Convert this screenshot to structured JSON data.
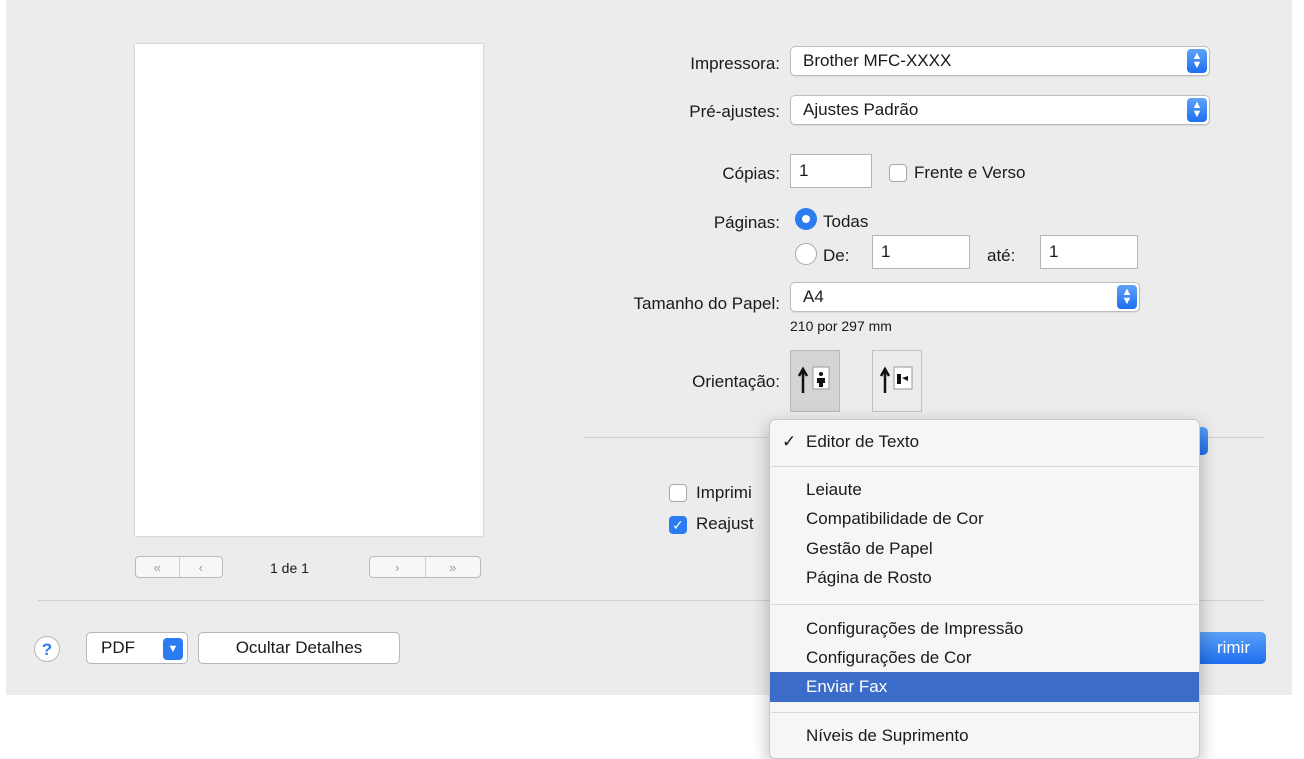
{
  "preview": {
    "page_indicator": "1 de 1"
  },
  "printer": {
    "label": "Impressora:",
    "value": "Brother MFC-XXXX"
  },
  "presets": {
    "label": "Pré-ajustes:",
    "value": "Ajustes Padrão"
  },
  "copies": {
    "label": "Cópias:",
    "value": "1",
    "duplex_label": "Frente e Verso"
  },
  "pages": {
    "label": "Páginas:",
    "all_label": "Todas",
    "from_label": "De:",
    "from_value": "1",
    "to_label": "até:",
    "to_value": "1"
  },
  "paper": {
    "label": "Tamanho do Papel:",
    "value": "A4",
    "dimensions": "210 por 297 mm"
  },
  "orientation": {
    "label": "Orientação:"
  },
  "options": {
    "print_label": "Imprimi",
    "scale_label": "Reajust"
  },
  "footer": {
    "help": "?",
    "pdf": "PDF",
    "hide_details": "Ocultar Detalhes",
    "print_button": "rimir"
  },
  "menu": {
    "selected": "Editor de Texto",
    "checkmark": "✓",
    "group1": [
      "Leiaute",
      "Compatibilidade de Cor",
      "Gestão de Papel",
      "Página de Rosto"
    ],
    "group2": [
      "Configurações de Impressão",
      "Configurações de Cor"
    ],
    "highlighted": "Enviar Fax",
    "group3": [
      "Níveis de Suprimento"
    ]
  },
  "colors": {
    "accent": "#2b7cf0",
    "menu_highlight": "#3b6cc9",
    "sheet_bg": "#ececec"
  }
}
